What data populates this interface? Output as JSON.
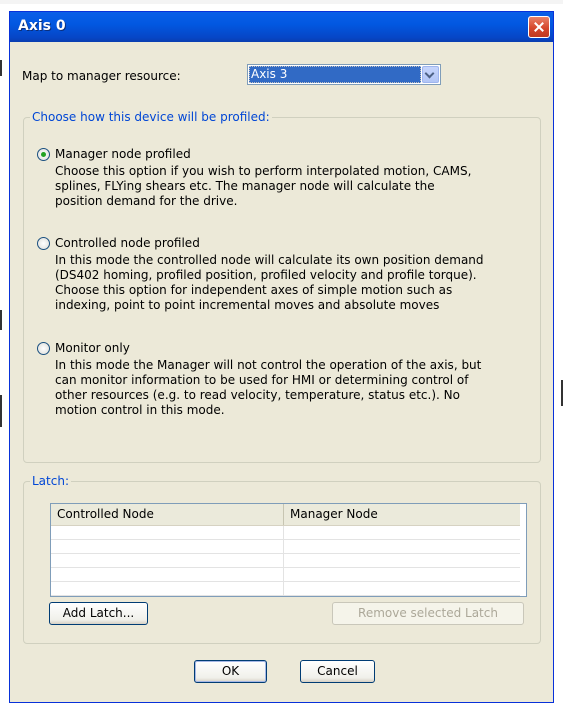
{
  "dialog": {
    "title": "Axis 0",
    "map_label": "Map to manager resource:",
    "map_value": "Axis 3",
    "profile_group": {
      "legend": "Choose how this device will be profiled:",
      "options": [
        {
          "label": "Manager node profiled",
          "checked": true,
          "description": [
            "Choose this option if you wish to perform interpolated motion, CAMS,",
            "splines, FLYing shears etc. The manager node will calculate the",
            "position demand for the drive."
          ]
        },
        {
          "label": "Controlled node profiled",
          "checked": false,
          "description": [
            "In this mode the controlled node will calculate its own position demand",
            "(DS402 homing, profiled position, profiled velocity and profile torque).",
            "Choose this option for independent axes of simple motion such as",
            "indexing, point to point incremental moves and absolute moves"
          ]
        },
        {
          "label": "Monitor only",
          "checked": false,
          "description": [
            "In this mode the Manager will not control the operation of the axis, but",
            "can monitor information to be used for HMI or determining control of",
            "other resources (e.g. to read velocity, temperature, status etc.). No",
            "motion control in this mode."
          ]
        }
      ]
    },
    "latch_group": {
      "legend": "Latch:",
      "columns": [
        "Controlled Node",
        "Manager Node"
      ],
      "add_button": "Add Latch...",
      "remove_button": "Remove selected Latch"
    },
    "ok_button": "OK",
    "cancel_button": "Cancel"
  }
}
